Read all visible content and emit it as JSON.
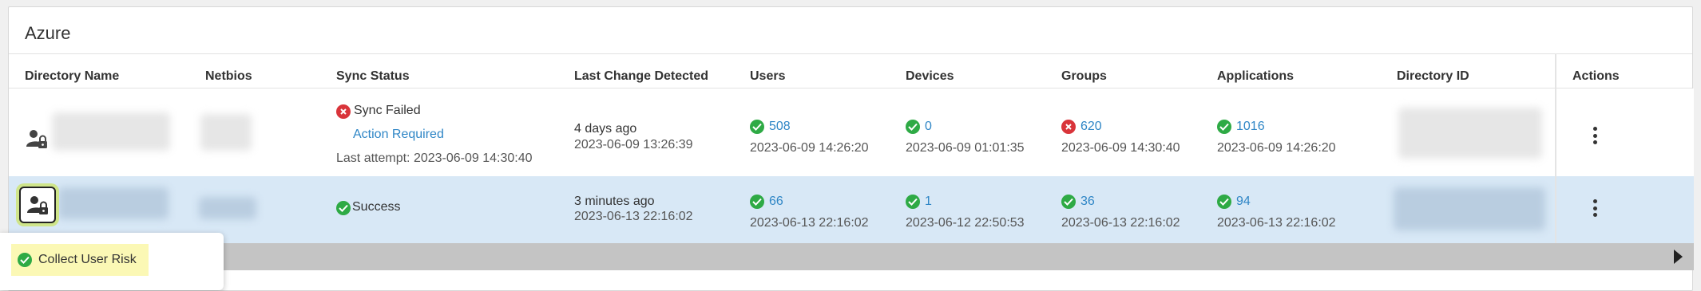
{
  "panel": {
    "title": "Azure"
  },
  "columns": [
    "Directory Name",
    "Netbios",
    "Sync Status",
    "Last Change Detected",
    "Users",
    "Devices",
    "Groups",
    "Applications",
    "Directory ID",
    "Actions"
  ],
  "rows": [
    {
      "sync_status": "Sync Failed",
      "sync_state": "error",
      "action_required": "Action Required",
      "last_attempt": "Last attempt: 2023-06-09 14:30:40",
      "last_change_relative": "4 days ago",
      "last_change_time": "2023-06-09 13:26:39",
      "users": {
        "count": "508",
        "time": "2023-06-09 14:26:20",
        "state": "ok"
      },
      "devices": {
        "count": "0",
        "time": "2023-06-09 01:01:35",
        "state": "ok"
      },
      "groups": {
        "count": "620",
        "time": "2023-06-09 14:30:40",
        "state": "error"
      },
      "applications": {
        "count": "1016",
        "time": "2023-06-09 14:26:20",
        "state": "ok"
      }
    },
    {
      "sync_status": "Success",
      "sync_state": "ok",
      "last_change_relative": "3 minutes ago",
      "last_change_time": "2023-06-13 22:16:02",
      "users": {
        "count": "66",
        "time": "2023-06-13 22:16:02",
        "state": "ok"
      },
      "devices": {
        "count": "1",
        "time": "2023-06-12 22:50:53",
        "state": "ok"
      },
      "groups": {
        "count": "36",
        "time": "2023-06-13 22:16:02",
        "state": "ok"
      },
      "applications": {
        "count": "94",
        "time": "2023-06-13 22:16:02",
        "state": "ok"
      }
    }
  ],
  "tooltip": {
    "label": "Collect User Risk",
    "state": "ok"
  },
  "colors": {
    "ok": "#2eaa45",
    "error": "#d9343a",
    "link": "#2f86c6",
    "selected_row": "#d8e8f6",
    "tooltip_highlight": "#fbf8b5"
  },
  "icons": {
    "directory": "user-lock-icon",
    "ok": "check-circle-icon",
    "error": "x-circle-icon",
    "actions": "kebab-menu-icon",
    "scroll": "arrow-right-icon"
  }
}
